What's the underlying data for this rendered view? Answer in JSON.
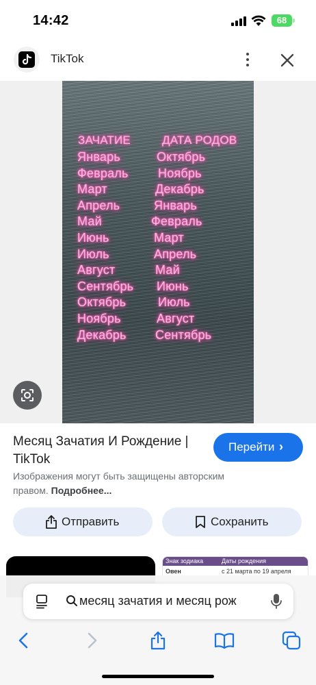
{
  "status_bar": {
    "time": "14:42",
    "battery": "68"
  },
  "site": {
    "name": "TikTok"
  },
  "image": {
    "headers": {
      "left": "ЗАЧАТИЕ",
      "right": "ДАТА РОДОВ"
    },
    "rows": [
      {
        "conception": "Январь",
        "birth": "Октябрь"
      },
      {
        "conception": "Февраль",
        "birth": "Ноябрь"
      },
      {
        "conception": "Март",
        "birth": "Декабрь"
      },
      {
        "conception": "Апрель",
        "birth": "Январь"
      },
      {
        "conception": "Май",
        "birth": "Февраль"
      },
      {
        "conception": "Июнь",
        "birth": "Март"
      },
      {
        "conception": "Июль",
        "birth": "Апрель"
      },
      {
        "conception": "Август",
        "birth": "Май"
      },
      {
        "conception": "Сентябрь",
        "birth": "Июнь"
      },
      {
        "conception": "Октябрь",
        "birth": "Июль"
      },
      {
        "conception": "Ноябрь",
        "birth": "Август"
      },
      {
        "conception": "Декабрь",
        "birth": "Сентябрь"
      }
    ]
  },
  "result": {
    "title": "Месяц Зачатия И Рождение | TikTok",
    "visit_label": "Перейти",
    "copyright_text": "Изображения могут быть защищены авторским правом.",
    "copyright_more": "Подробнее..."
  },
  "actions": {
    "share_label": "Отправить",
    "save_label": "Сохранить"
  },
  "related": {
    "table_headers": {
      "sign": "Знак зодиака",
      "dates": "Даты рождения"
    },
    "table_row": {
      "sign": "Овен",
      "dates": "с 21 марта по 19 апреля"
    }
  },
  "browser": {
    "address_text": "месяц зачатия и месяц рож"
  },
  "colors": {
    "accent": "#1a73e8",
    "neon": "#ff4fb4",
    "action_bg": "#e8eef9"
  },
  "icons": [
    "tiktok-logo",
    "more-vertical-icon",
    "close-icon",
    "lens-icon",
    "share-icon",
    "bookmark-icon",
    "reader-icon",
    "search-icon",
    "mic-icon",
    "back-icon",
    "forward-icon",
    "share-icon",
    "bookmarks-icon",
    "tabs-icon"
  ]
}
